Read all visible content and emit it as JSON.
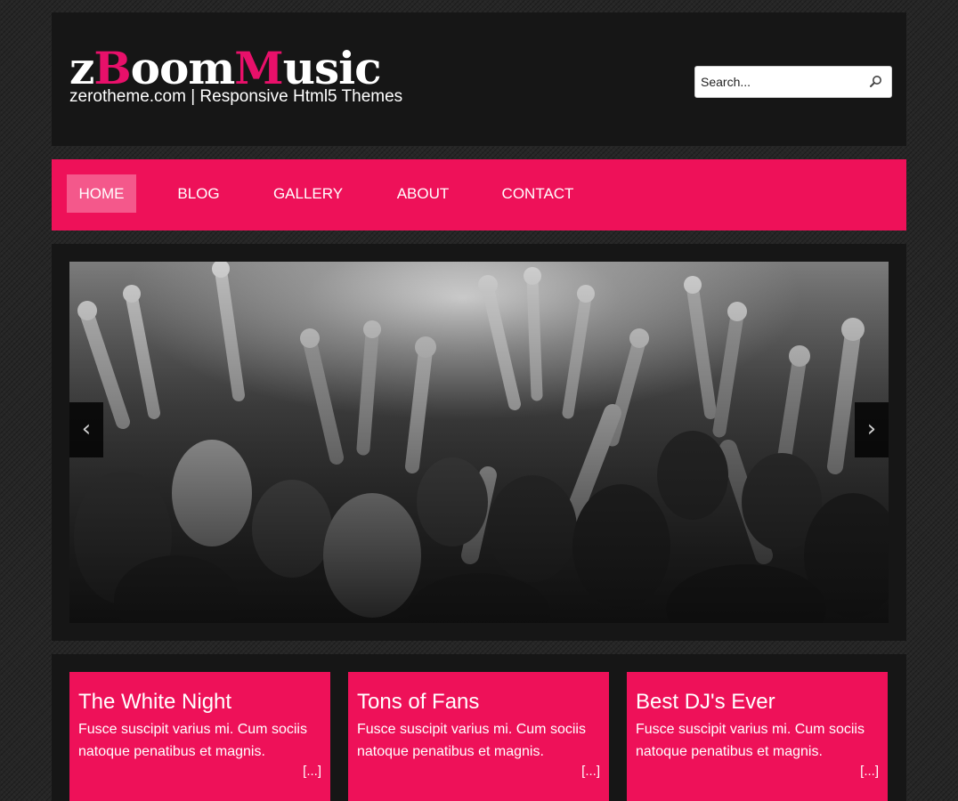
{
  "header": {
    "logo": {
      "part1": "z",
      "part2": "B",
      "part3": "oom",
      "part4": "M",
      "part5": "usic"
    },
    "tagline": "zerotheme.com | Responsive Html5 Themes",
    "search": {
      "placeholder": "Search...",
      "icon": "search-icon"
    }
  },
  "nav": {
    "items": [
      {
        "label": "HOME",
        "active": true
      },
      {
        "label": "BLOG"
      },
      {
        "label": "GALLERY"
      },
      {
        "label": "ABOUT"
      },
      {
        "label": "CONTACT"
      }
    ]
  },
  "slider": {
    "prev_label": "‹",
    "next_label": "›",
    "image": "concert-crowd-grayscale"
  },
  "features": [
    {
      "title": "The White Night",
      "text": "Fusce suscipit varius mi. Cum sociis natoque penatibus et magnis.",
      "more": "[...]"
    },
    {
      "title": "Tons of Fans",
      "text": "Fusce suscipit varius mi. Cum sociis natoque penatibus et magnis.",
      "more": "[...]"
    },
    {
      "title": "Best DJ's Ever",
      "text": "Fusce suscipit varius mi. Cum sociis natoque penatibus et magnis.",
      "more": "[...]"
    }
  ],
  "colors": {
    "accent": "#ee1159",
    "active_nav": "#f4588b",
    "panel": "#161616",
    "background": "#262626"
  }
}
